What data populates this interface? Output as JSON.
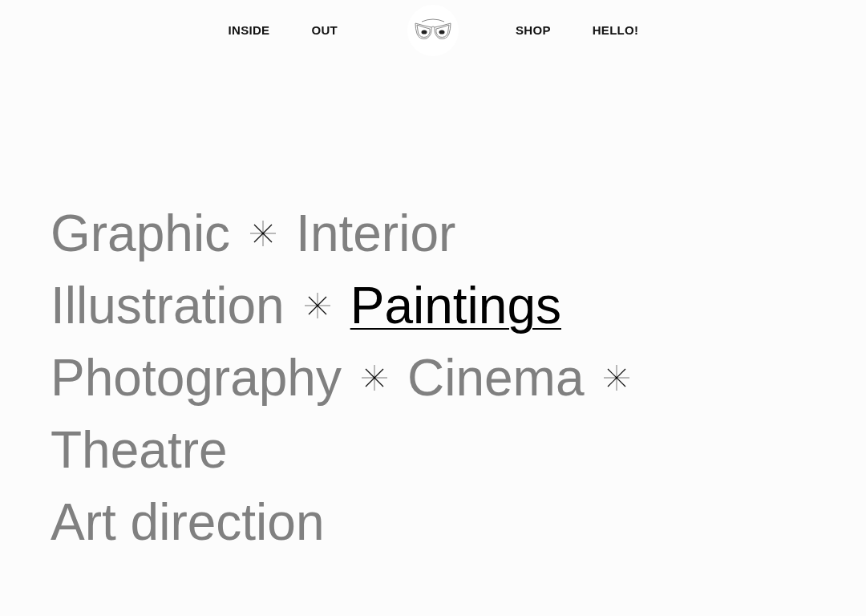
{
  "nav": {
    "left_links": [
      "INSIDE",
      "OUT"
    ],
    "right_links": [
      "SHOP",
      "HELLO!"
    ]
  },
  "category_rows": [
    {
      "items": [
        {
          "label": "Graphic",
          "selected": false,
          "star_after": true
        },
        {
          "label": "Interior",
          "selected": false,
          "star_after": false
        }
      ]
    },
    {
      "items": [
        {
          "label": "Illustration",
          "selected": false,
          "star_after": true
        },
        {
          "label": "Paintings",
          "selected": true,
          "star_after": false
        }
      ]
    },
    {
      "items": [
        {
          "label": "Photography",
          "selected": false,
          "star_after": true
        },
        {
          "label": "Cinema",
          "selected": false,
          "star_after": true
        }
      ]
    },
    {
      "items": [
        {
          "label": "Theatre",
          "selected": false,
          "star_after": false
        }
      ]
    },
    {
      "items": [
        {
          "label": "Art direction",
          "selected": false,
          "star_after": false
        }
      ]
    }
  ]
}
